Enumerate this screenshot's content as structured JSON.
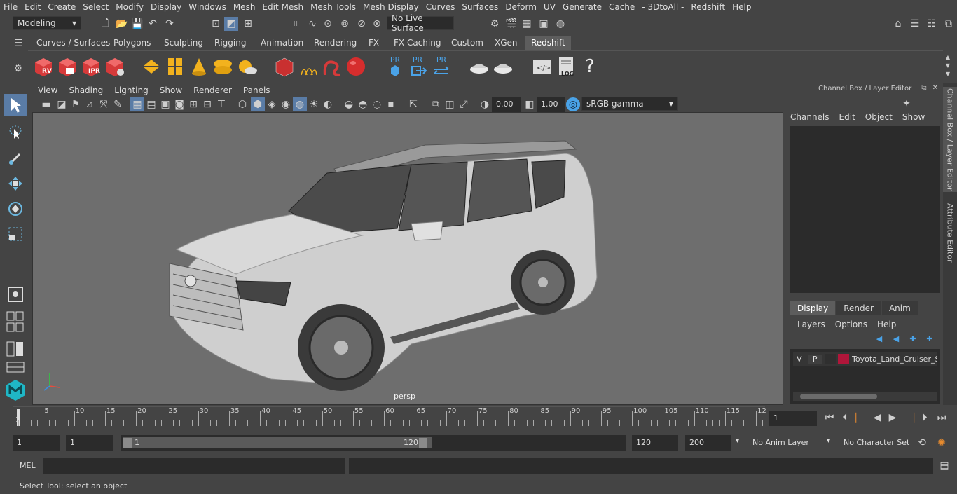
{
  "menubar": [
    "File",
    "Edit",
    "Create",
    "Select",
    "Modify",
    "Display",
    "Windows",
    "Mesh",
    "Edit Mesh",
    "Mesh Tools",
    "Mesh Display",
    "Curves",
    "Surfaces",
    "Deform",
    "UV",
    "Generate",
    "Cache",
    "- 3DtoAll -",
    "Redshift",
    "Help"
  ],
  "status": {
    "mode": "Modeling",
    "live_surface": "No Live Surface"
  },
  "shelf_tabs": [
    "Curves / Surfaces",
    "Polygons",
    "Sculpting",
    "Rigging",
    "Animation",
    "Rendering",
    "FX",
    "FX Caching",
    "Custom",
    "XGen",
    "Redshift"
  ],
  "shelf_active": "Redshift",
  "shelf_icon_labels": {
    "rv": "RV",
    "ipr": "IPR",
    "pr1": "PR",
    "pr2": "PR",
    "pr3": "PR",
    "log": "LOG"
  },
  "panel_menu": [
    "View",
    "Shading",
    "Lighting",
    "Show",
    "Renderer",
    "Panels"
  ],
  "panel_tools": {
    "exposure": "0.00",
    "gamma": "1.00",
    "color_space": "sRGB gamma"
  },
  "viewport": {
    "camera_label": "persp"
  },
  "channel_box": {
    "title": "Channel Box / Layer Editor",
    "menu": [
      "Channels",
      "Edit",
      "Object",
      "Show"
    ],
    "layer_tabs": [
      "Display",
      "Render",
      "Anim"
    ],
    "layer_menu": [
      "Layers",
      "Options",
      "Help"
    ],
    "layer": {
      "v": "V",
      "p": "P",
      "name": "Toyota_Land_Cruiser_S",
      "color": "#b0163a"
    }
  },
  "side_tabs": [
    "Channel Box / Layer Editor",
    "Attribute Editor"
  ],
  "timeline": {
    "ticks": [
      "5",
      "10",
      "15",
      "20",
      "25",
      "30",
      "35",
      "40",
      "45",
      "50",
      "55",
      "60",
      "65",
      "70",
      "75",
      "80",
      "85",
      "90",
      "95",
      "100",
      "105",
      "110",
      "115",
      "12"
    ],
    "start_label": "1",
    "current_frame": "1"
  },
  "range": {
    "start": "1",
    "start2": "1",
    "slider_start": "1",
    "slider_end": "120",
    "end": "120",
    "end2": "200",
    "anim_layer": "No Anim Layer",
    "char_set": "No Character Set"
  },
  "mel": {
    "label": "MEL"
  },
  "help_line": "Select Tool: select an object"
}
